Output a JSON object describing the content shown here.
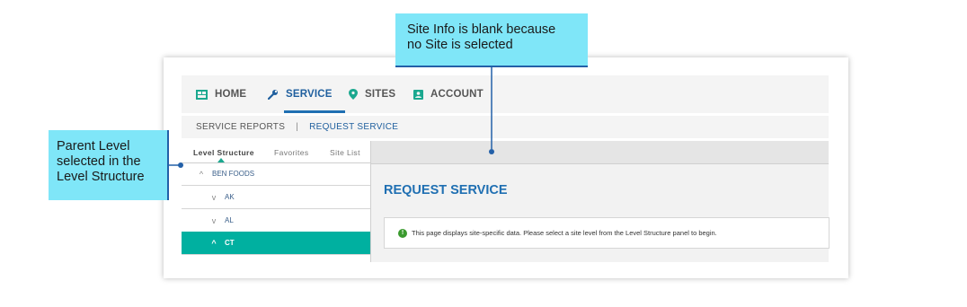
{
  "nav": {
    "home": "HOME",
    "service": "SERVICE",
    "sites": "SITES",
    "account": "ACCOUNT",
    "active": "SERVICE"
  },
  "subnav": {
    "service_reports": "SERVICE REPORTS",
    "separator": "|",
    "request_service": "REQUEST SERVICE"
  },
  "panel": {
    "tabs": [
      "Level Structure",
      "Favorites",
      "Site List"
    ],
    "tree": [
      {
        "label": "BEN FOODS",
        "chevron": "^",
        "selected": false
      },
      {
        "label": "AK",
        "chevron": "v",
        "selected": false
      },
      {
        "label": "AL",
        "chevron": "v",
        "selected": false
      },
      {
        "label": "CT",
        "chevron": "^",
        "selected": true
      }
    ]
  },
  "content": {
    "title": "REQUEST SERVICE",
    "notice": "This page displays site-specific data. Please select a site level from the Level Structure panel to begin."
  },
  "callouts": {
    "top": [
      "Site Info is blank because",
      "no Site is selected"
    ],
    "left": [
      "Parent  Level",
      "selected in the",
      "Level Structure"
    ]
  },
  "colors": {
    "accent_blue": "#1f6fb2",
    "selected_teal": "#00b0a0",
    "callout_bg": "#7fe6f8",
    "callout_line": "#2360a8",
    "info_green": "#3a9a2e"
  },
  "icons": {
    "home": "home-grid-icon",
    "service": "wrench-icon",
    "sites": "map-pin-icon",
    "account": "account-card-icon",
    "notice": "info-icon"
  }
}
